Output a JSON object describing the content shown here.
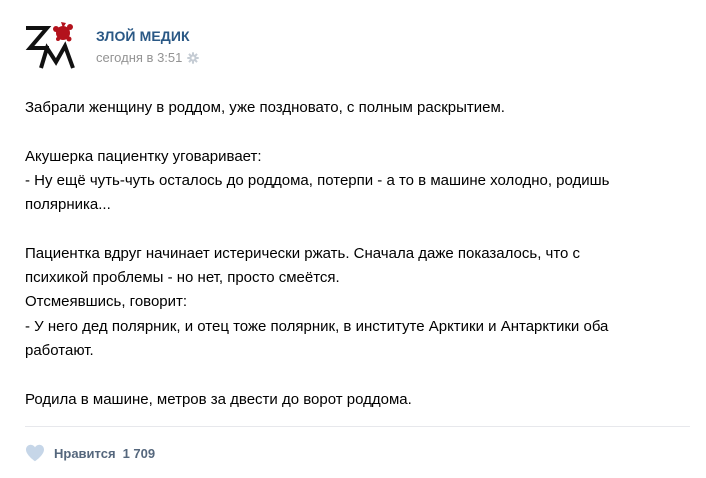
{
  "post": {
    "author": "ЗЛОЙ МЕДИК",
    "date": "сегодня в 3:51",
    "icons": {
      "avatar": "zm-logo-avatar",
      "settings": "gear-icon",
      "like": "heart-icon"
    },
    "colors": {
      "author": "#2a5885",
      "date": "#939393",
      "like": "#55677d",
      "heart": "#c6d6e8",
      "avatar_red": "#b3121c"
    },
    "paragraphs": [
      [
        "Забрали женщину в роддом, уже поздновато, с полным раскрытием."
      ],
      [
        "Акушерка пациентку уговаривает:",
        "- Ну ещё чуть-чуть осталось до роддома, потерпи - а то в машине холодно, родишь",
        "полярника..."
      ],
      [
        "Пациентка вдруг начинает истерически ржать. Сначала даже показалось, что с",
        "психикой проблемы - но нет, просто смеётся.",
        "Отсмеявшись, говорит:",
        "- У него дед полярник, и отец тоже полярник, в институте Арктики и Антарктики оба",
        "работают."
      ],
      [
        "Родила в машине, метров за двести до ворот роддома."
      ]
    ],
    "likes": {
      "label": "Нравится",
      "count": "1 709"
    }
  }
}
